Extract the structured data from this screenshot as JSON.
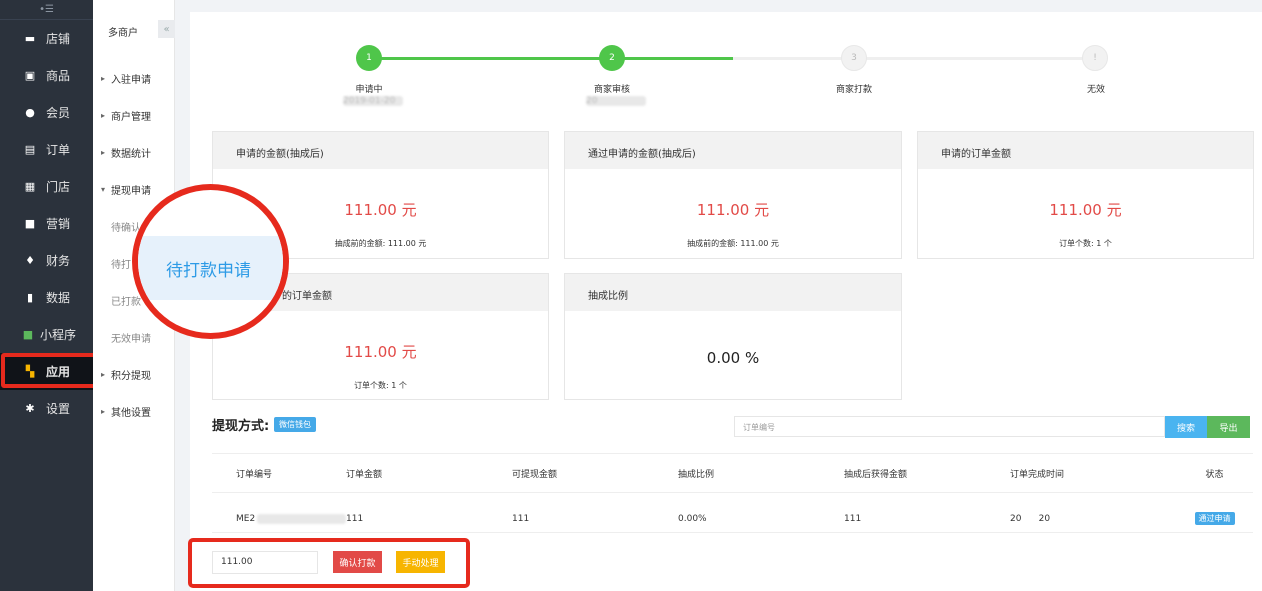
{
  "sidebar": {
    "items": [
      {
        "label": "店铺",
        "icon": "store-icon"
      },
      {
        "label": "商品",
        "icon": "goods-icon"
      },
      {
        "label": "会员",
        "icon": "user-icon"
      },
      {
        "label": "订单",
        "icon": "order-icon"
      },
      {
        "label": "门店",
        "icon": "shop-icon"
      },
      {
        "label": "营销",
        "icon": "gift-icon"
      },
      {
        "label": "财务",
        "icon": "money-icon"
      },
      {
        "label": "数据",
        "icon": "chart-icon"
      },
      {
        "label": "小程序",
        "icon": "miniapp-icon"
      },
      {
        "label": "应用",
        "icon": "apps-icon"
      },
      {
        "label": "设置",
        "icon": "gear-icon"
      }
    ]
  },
  "subnav": {
    "title": "多商户",
    "items": [
      {
        "label": "入驻申请"
      },
      {
        "label": "商户管理"
      },
      {
        "label": "数据统计"
      },
      {
        "label": "提现申请"
      }
    ],
    "children": [
      "待确认",
      "待打",
      "已打款",
      "无效申请"
    ],
    "items_after": [
      {
        "label": "积分提现"
      },
      {
        "label": "其他设置"
      }
    ]
  },
  "zoom": {
    "label": "待打款申请"
  },
  "steps": [
    {
      "num": "1",
      "label": "申请中",
      "sub": "2019-01-20"
    },
    {
      "num": "2",
      "label": "商家审核",
      "sub": "20"
    },
    {
      "num": "3",
      "label": "商家打款",
      "sub": ""
    },
    {
      "num": "!",
      "label": "无效",
      "sub": ""
    }
  ],
  "cards": [
    {
      "head": "申请的金额(抽成后)",
      "amount": "111.00 元",
      "note": "抽成前的金额: 111.00 元"
    },
    {
      "head": "通过申请的金额(抽成后)",
      "amount": "111.00 元",
      "note": "抽成前的金额: 111.00 元"
    },
    {
      "head": "申请的订单金额",
      "amount": "111.00 元",
      "note": "订单个数: 1 个"
    },
    {
      "head": "的订单金额",
      "amount": "111.00 元",
      "note": "订单个数: 1 个"
    },
    {
      "head": "抽成比例",
      "ratio": "0.00 %"
    }
  ],
  "withdraw": {
    "title": "提现方式:",
    "method": "微信钱包"
  },
  "search": {
    "placeholder": "订单编号",
    "search_label": "搜索",
    "export_label": "导出"
  },
  "table": {
    "headers": [
      "订单编号",
      "订单金额",
      "可提现金额",
      "抽成比例",
      "抽成后获得金额",
      "订单完成时间",
      "状态"
    ],
    "rows": [
      {
        "order_no": "ME2",
        "amount": "111",
        "withdrawable": "111",
        "ratio": "0.00%",
        "after": "111",
        "time": "20      20",
        "status": "通过申请"
      }
    ]
  },
  "actions": {
    "amount_value": "111.00",
    "confirm_label": "确认打款",
    "manual_label": "手动处理"
  }
}
